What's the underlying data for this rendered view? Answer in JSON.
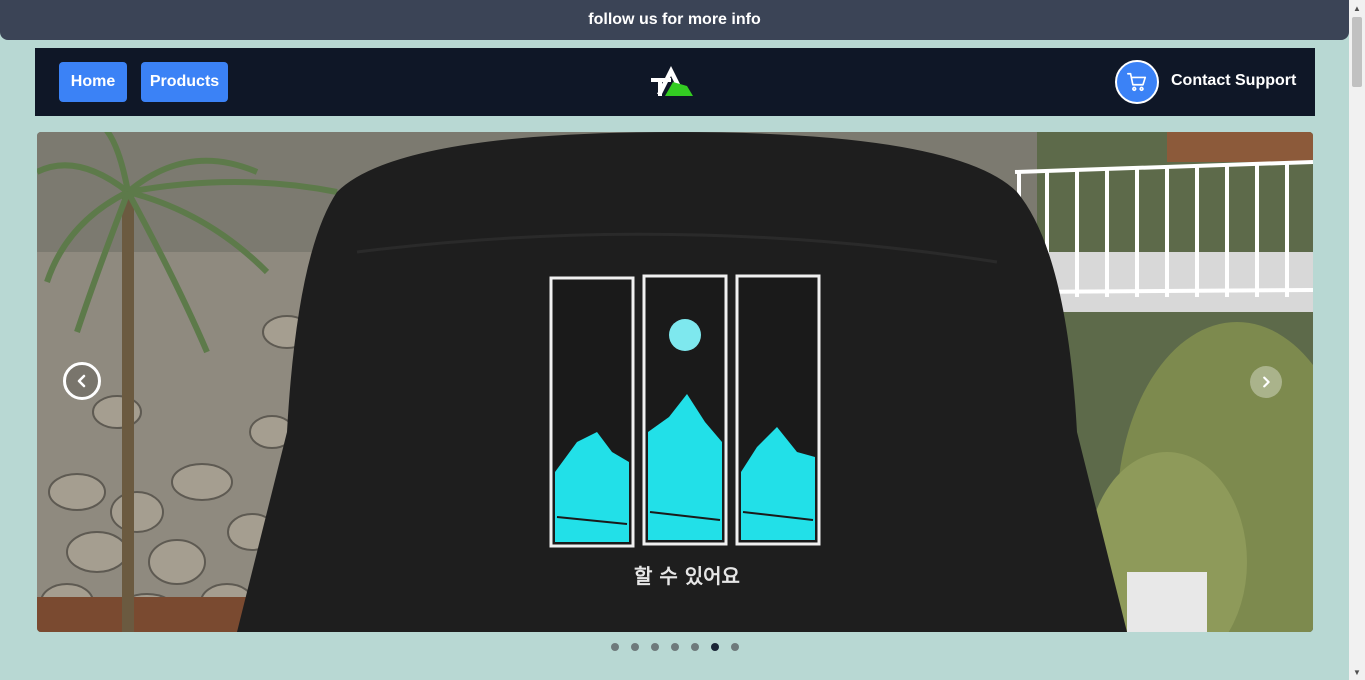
{
  "banner": {
    "text": "follow us for more info"
  },
  "nav": {
    "home_label": "Home",
    "products_label": "Products",
    "contact_label": "Contact Support",
    "cart_icon": "cart-icon",
    "logo_icon": "brand-logo"
  },
  "carousel": {
    "caption": "할 수 있어요",
    "prev_icon": "chevron-left-icon",
    "next_icon": "chevron-right-icon",
    "slide_count": 7,
    "active_index": 5
  },
  "colors": {
    "banner_bg": "#3b4456",
    "navbar_bg": "#0f1727",
    "accent": "#3b82f6",
    "page_bg": "#b8d8d3",
    "print_cyan": "#22e0e8"
  }
}
